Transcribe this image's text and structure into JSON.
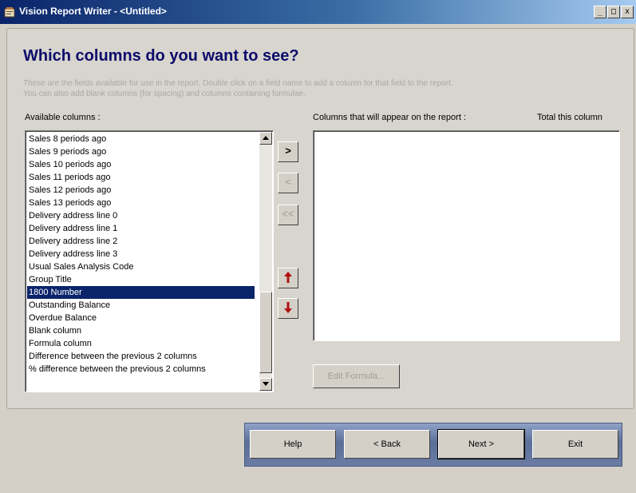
{
  "window": {
    "title": "Vision Report Writer - <Untitled>",
    "controls": {
      "minimize": "_",
      "maximize": "□",
      "close": "x"
    }
  },
  "page": {
    "heading": "Which columns do you want to see?",
    "description": "These are the fields available for use in the report. Double click on a field name to add a column for that field to the report.\nYou can also add blank columns (for spacing) and columns containing formulae."
  },
  "available": {
    "label": "Available columns :",
    "items": [
      "Sales 8 periods ago",
      "Sales 9 periods ago",
      "Sales 10 periods ago",
      "Sales 11 periods ago",
      "Sales 12 periods ago",
      "Sales 13 periods ago",
      "Delivery address line 0",
      "Delivery address line 1",
      "Delivery address line 2",
      "Delivery address line 3",
      "Usual Sales Analysis Code",
      "Group Title",
      "1800 Number",
      "Outstanding Balance",
      "Overdue Balance",
      "Blank column",
      "Formula column",
      "Difference between the previous 2 columns",
      "% difference between the previous 2 columns"
    ],
    "selected_index": 12
  },
  "report": {
    "label": "Columns that will appear on the report :",
    "total_label": "Total this column",
    "items": []
  },
  "buttons": {
    "add": ">",
    "remove": "<",
    "remove_all": "<<",
    "edit_formula": "Edit Formula...",
    "help": "Help",
    "back": "< Back",
    "next": "Next >",
    "exit": "Exit"
  },
  "colors": {
    "heading": "#0b0b6b",
    "selection": "#0a246a",
    "arrow": "#b01010"
  },
  "icons": {
    "move_up": "red-up-arrow-icon",
    "move_down": "red-down-arrow-icon"
  }
}
